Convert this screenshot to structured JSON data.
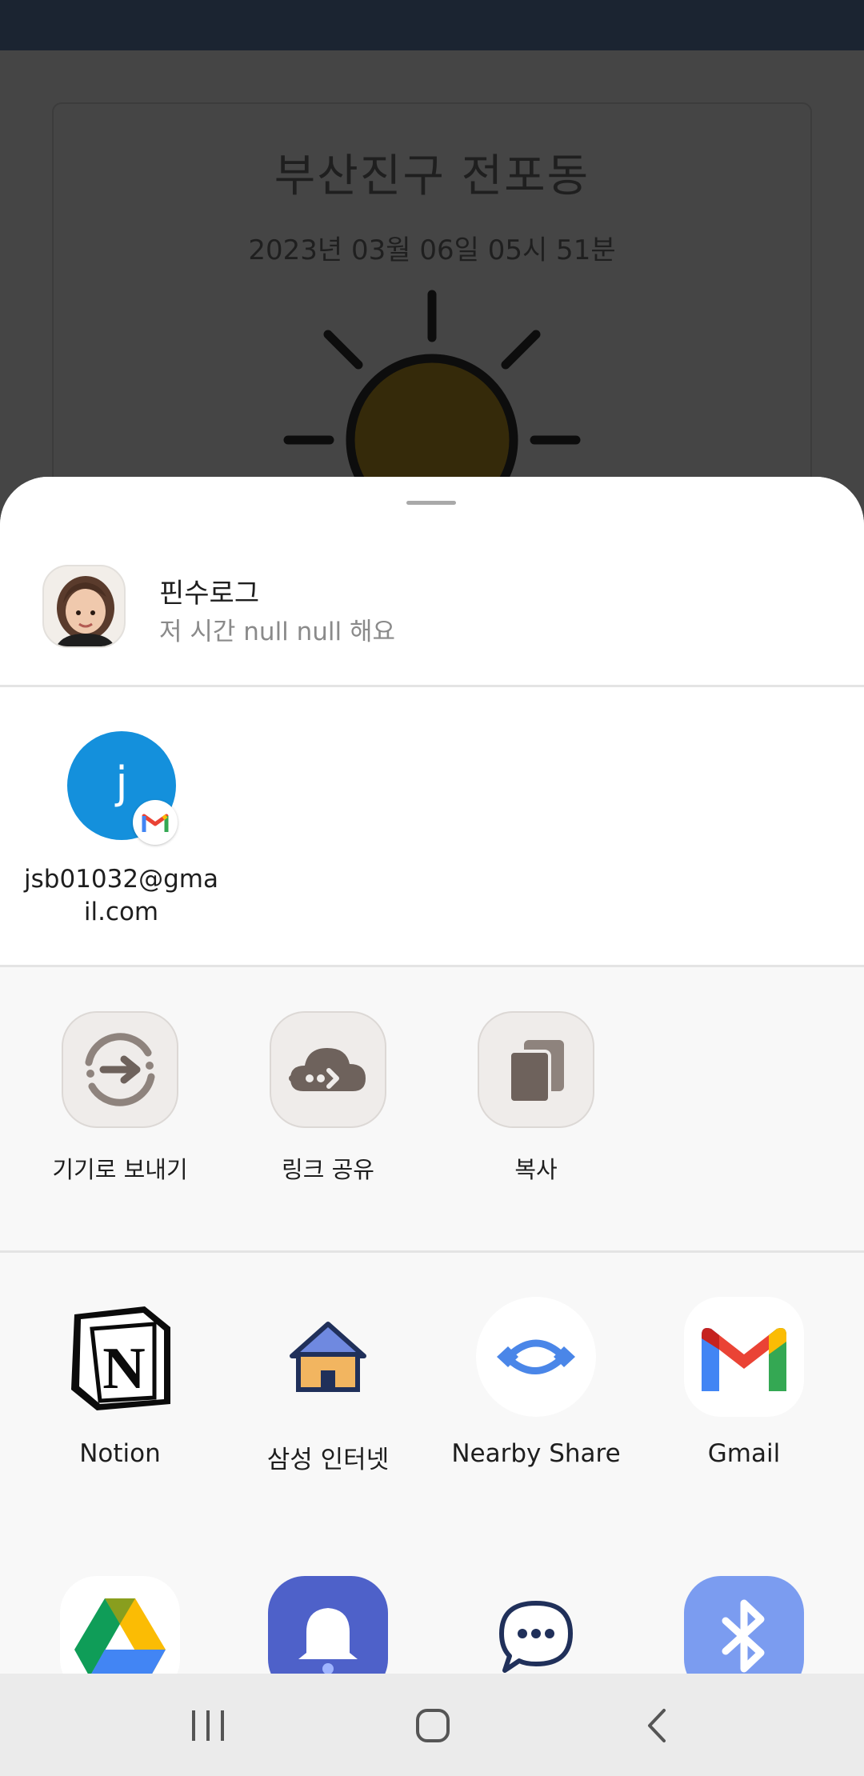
{
  "background": {
    "location_title": "부산진구 전포동",
    "datetime": "2023년 03월 06일 05시 51분",
    "weather_icon": "sun-icon"
  },
  "share_sheet": {
    "preview": {
      "title": "핀수로그",
      "text": "저 시간 null null 해요",
      "avatar_icon": "memoji-avatar"
    },
    "direct_share": [
      {
        "initial": "j",
        "name": "jsb01032@gmail.com",
        "badge_icon": "gmail-icon"
      }
    ],
    "actions": [
      {
        "label": "기기로 보내기",
        "icon": "send-to-device-icon"
      },
      {
        "label": "링크 공유",
        "icon": "cloud-link-icon"
      },
      {
        "label": "복사",
        "icon": "copy-icon"
      }
    ],
    "apps": [
      {
        "label": "Notion",
        "icon": "notion-icon"
      },
      {
        "label": "삼성 인터넷",
        "icon": "samsung-internet-icon"
      },
      {
        "label": "Nearby Share",
        "icon": "nearby-share-icon"
      },
      {
        "label": "Gmail",
        "icon": "gmail-icon"
      },
      {
        "label": "",
        "icon": "google-drive-icon"
      },
      {
        "label": "",
        "icon": "reminder-bell-icon"
      },
      {
        "label": "",
        "icon": "messages-icon"
      },
      {
        "label": "",
        "icon": "bluetooth-icon"
      }
    ]
  },
  "navbar": {
    "buttons": [
      "recent-apps",
      "home",
      "back"
    ]
  },
  "colors": {
    "status_bar": "#1b2431",
    "dim_overlay": "#454545",
    "sheet_bg": "#fafafa",
    "contact_blue": "#1490dc",
    "action_icon_fg": "#6e625c"
  }
}
